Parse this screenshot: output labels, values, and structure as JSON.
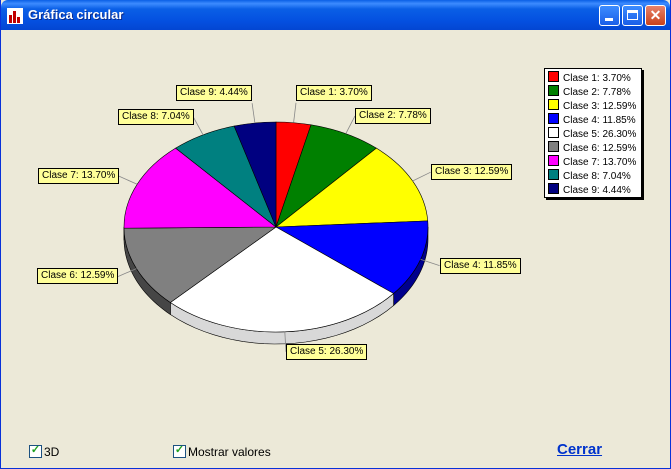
{
  "window": {
    "title": "Gráfica circular",
    "close_glyph": "✕"
  },
  "colors": {
    "slices": [
      "#FF0000",
      "#008000",
      "#FFFF00",
      "#0000FF",
      "#FFFFFF",
      "#808080",
      "#FF00FF",
      "#008080",
      "#000080"
    ],
    "label_bg": "#FFFF99",
    "window_bg": "#ECE9D8"
  },
  "chart_data": {
    "type": "pie",
    "three_d": true,
    "legend_position": "top-right",
    "categories": [
      "Clase 1",
      "Clase 2",
      "Clase 3",
      "Clase 4",
      "Clase 5",
      "Clase 6",
      "Clase 7",
      "Clase 8",
      "Clase 9"
    ],
    "values": [
      3.7,
      7.78,
      12.59,
      11.85,
      26.3,
      12.59,
      13.7,
      7.04,
      4.44
    ],
    "labels": [
      "Clase 1: 3.70%",
      "Clase 2: 7.78%",
      "Clase 3: 12.59%",
      "Clase 4: 11.85%",
      "Clase 5: 26.30%",
      "Clase 6: 12.59%",
      "Clase 7: 13.70%",
      "Clase 8: 7.04%",
      "Clase 9: 4.44%"
    ]
  },
  "controls": {
    "check_3d": {
      "label": "3D",
      "checked": true,
      "check_glyph": "✓"
    },
    "check_values": {
      "label": "Mostrar valores",
      "checked": true,
      "check_glyph": "✓"
    },
    "close_link": "Cerrar"
  },
  "icons": {
    "app": "chart-app-icon",
    "minimize": "minimize-icon",
    "maximize": "maximize-icon",
    "close": "close-icon"
  }
}
